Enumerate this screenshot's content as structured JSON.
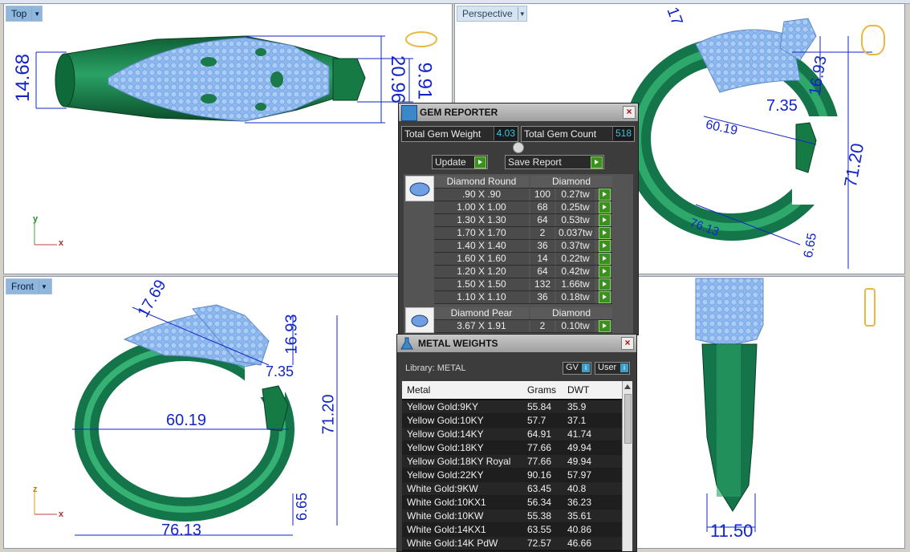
{
  "viewports": {
    "top": {
      "label": "Top",
      "dims": [
        "14.68",
        "20.96",
        "9.91"
      ],
      "axes": [
        "y",
        "x"
      ]
    },
    "perspective": {
      "label": "Perspective",
      "dims": [
        "17",
        "16.93",
        "7.35",
        "60.19",
        "71.20",
        "76.13",
        "6.65"
      ]
    },
    "front": {
      "label": "Front",
      "dims": [
        "17.69",
        "16.93",
        "7.35",
        "60.19",
        "71.20",
        "6.65",
        "76.13"
      ],
      "axes": [
        "z",
        "x"
      ]
    },
    "right": {
      "dims": [
        "11.50"
      ]
    }
  },
  "gem_reporter": {
    "title": "GEM REPORTER",
    "total_weight_label": "Total Gem Weight",
    "total_weight": "4.03",
    "total_count_label": "Total Gem Count",
    "total_count": "518",
    "update_label": "Update",
    "save_label": "Save Report",
    "groups": [
      {
        "name": "Diamond Round",
        "material": "Diamond",
        "rows": [
          {
            "size": ".90 X .90",
            "count": "100",
            "weight": "0.27tw"
          },
          {
            "size": "1.00 X 1.00",
            "count": "68",
            "weight": "0.25tw"
          },
          {
            "size": "1.30 X 1.30",
            "count": "64",
            "weight": "0.53tw"
          },
          {
            "size": "1.70 X 1.70",
            "count": "2",
            "weight": "0.037tw"
          },
          {
            "size": "1.40 X 1.40",
            "count": "36",
            "weight": "0.37tw"
          },
          {
            "size": "1.60 X 1.60",
            "count": "14",
            "weight": "0.22tw"
          },
          {
            "size": "1.20 X 1.20",
            "count": "64",
            "weight": "0.42tw"
          },
          {
            "size": "1.50 X 1.50",
            "count": "132",
            "weight": "1.66tw"
          },
          {
            "size": "1.10 X 1.10",
            "count": "36",
            "weight": "0.18tw"
          }
        ]
      },
      {
        "name": "Diamond Pear",
        "material": "Diamond",
        "rows": [
          {
            "size": "3.67 X 1.91",
            "count": "2",
            "weight": "0.10tw"
          }
        ]
      }
    ]
  },
  "metal_weights": {
    "title": "METAL WEIGHTS",
    "library_label": "Library: METAL",
    "gv_label": "GV",
    "user_label": "User",
    "headers": [
      "Metal",
      "Grams",
      "DWT"
    ],
    "rows": [
      [
        "Yellow Gold:9KY",
        "55.84",
        "35.9"
      ],
      [
        "Yellow Gold:10KY",
        "57.7",
        "37.1"
      ],
      [
        "Yellow Gold:14KY",
        "64.91",
        "41.74"
      ],
      [
        "Yellow Gold:18KY",
        "77.66",
        "49.94"
      ],
      [
        "Yellow Gold:18KY Royal",
        "77.66",
        "49.94"
      ],
      [
        "Yellow Gold:22KY",
        "90.16",
        "57.97"
      ],
      [
        "White Gold:9KW",
        "63.45",
        "40.8"
      ],
      [
        "White Gold:10KX1",
        "56.34",
        "36.23"
      ],
      [
        "White Gold:10KW",
        "55.38",
        "35.61"
      ],
      [
        "White Gold:14KX1",
        "63.55",
        "40.86"
      ],
      [
        "White Gold:14K PdW",
        "72.57",
        "46.66"
      ]
    ]
  },
  "colors": {
    "metal": "#1a7a4a",
    "gem": "#8ab8f0",
    "dimension": "#1226c8",
    "panel": "#3c3c3c",
    "value_text": "#39c5e8"
  }
}
